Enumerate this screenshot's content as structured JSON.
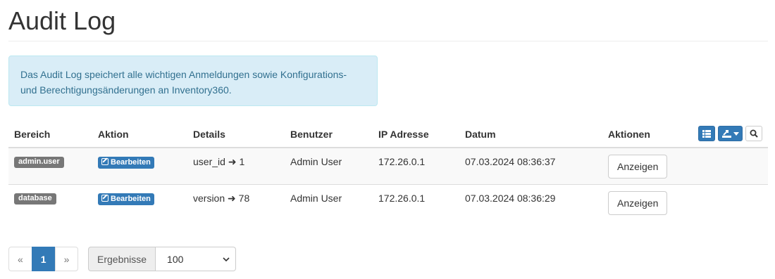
{
  "page": {
    "title": "Audit Log",
    "info": "Das Audit Log speichert alle wichtigen Anmeldungen sowie Konfigurations- und Berechtigungsänderungen an Inventory360."
  },
  "table": {
    "headers": [
      "Bereich",
      "Aktion",
      "Details",
      "Benutzer",
      "IP Adresse",
      "Datum",
      "Aktionen"
    ],
    "rows": [
      {
        "area": "admin.user",
        "action": "Bearbeiten",
        "detail_key": "user_id",
        "detail_value": "1",
        "user": "Admin User",
        "ip": "172.26.0.1",
        "date": "07.03.2024 08:36:37",
        "button": "Anzeigen"
      },
      {
        "area": "database",
        "action": "Bearbeiten",
        "detail_key": "version",
        "detail_value": "78",
        "user": "Admin User",
        "ip": "172.26.0.1",
        "date": "07.03.2024 08:36:29",
        "button": "Anzeigen"
      }
    ]
  },
  "toolbar": {
    "icons": [
      "list-view-icon",
      "export-icon",
      "search-icon"
    ]
  },
  "pagination": {
    "prev": "«",
    "current": "1",
    "next": "»",
    "results_label": "Ergebnisse",
    "results_value": "100"
  },
  "colors": {
    "primary": "#337ab7",
    "label_gray": "#777777",
    "info_bg": "#d9edf7",
    "info_text": "#31708f"
  }
}
